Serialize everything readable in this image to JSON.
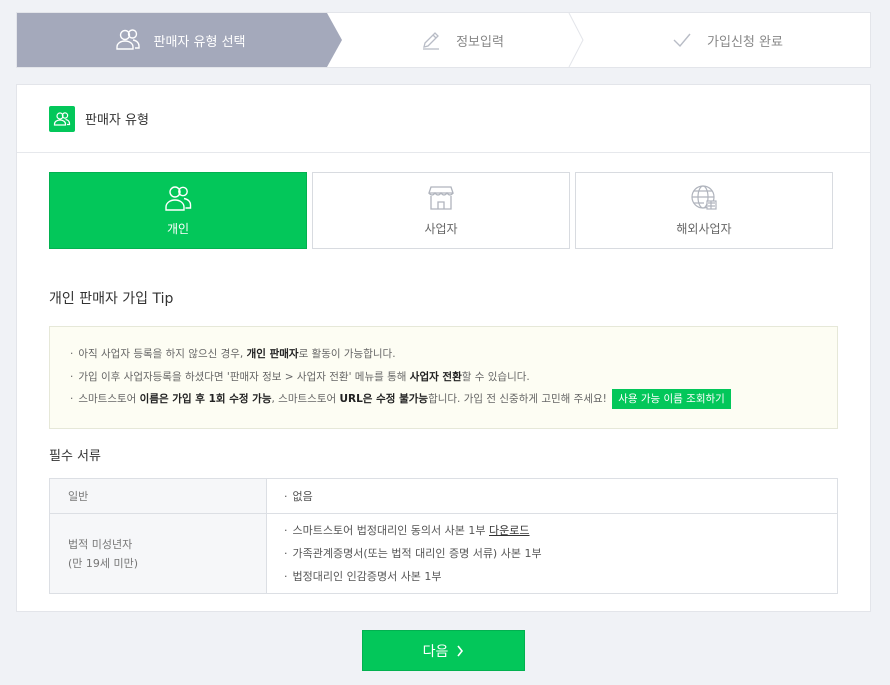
{
  "stepper": {
    "steps": [
      {
        "label": "판매자 유형 선택",
        "icon": "users-icon",
        "active": true
      },
      {
        "label": "정보입력",
        "icon": "pencil-icon",
        "active": false
      },
      {
        "label": "가입신청 완료",
        "icon": "check-icon",
        "active": false
      }
    ]
  },
  "card": {
    "title": "판매자 유형",
    "types": [
      {
        "label": "개인",
        "icon": "person-icon",
        "active": true
      },
      {
        "label": "사업자",
        "icon": "store-icon",
        "active": false
      },
      {
        "label": "해외사업자",
        "icon": "globe-icon",
        "active": false
      }
    ],
    "tip_title": "개인 판매자 가입 Tip",
    "tips": {
      "t1_pre": "아직 사업자 등록을 하지 않으신 경우, ",
      "t1_bold": "개인 판매자",
      "t1_post": "로 활동이 가능합니다.",
      "t2_pre": "가입 이후 사업자등록을 하셨다면 '판매자 정보 > 사업자 전환' 메뉴를 통해 ",
      "t2_bold": "사업자 전환",
      "t2_post": "할 수 있습니다.",
      "t3_pre": "스마트스토어 ",
      "t3_bold1": "이름은 가입 후 1회 수정 가능",
      "t3_mid": ", 스마트스토어 ",
      "t3_bold2": "URL은 수정 불가능",
      "t3_post": "합니다. 가입 전 신중하게 고민해 주세요!",
      "lookup_button": "사용 가능 이름 조회하기"
    },
    "docs_title": "필수 서류",
    "docs": {
      "general_label": "일반",
      "general_value": "없음",
      "minor_label_line1": "법적 미성년자",
      "minor_label_line2": "(만 19세 미만)",
      "minor_item1": "스마트스토어 법정대리인 동의서 사본 1부 ",
      "minor_item1_link": "다운로드",
      "minor_item2": "가족관계증명서(또는 법적 대리인 증명 서류) 사본 1부",
      "minor_item3": "법정대리인 인감증명서 사본 1부"
    }
  },
  "next_button": "다음",
  "colors": {
    "accent": "#03c75a",
    "step_active": "#a4a9bb",
    "background": "#f0f2f6",
    "tip_background": "#fdfdf3"
  }
}
